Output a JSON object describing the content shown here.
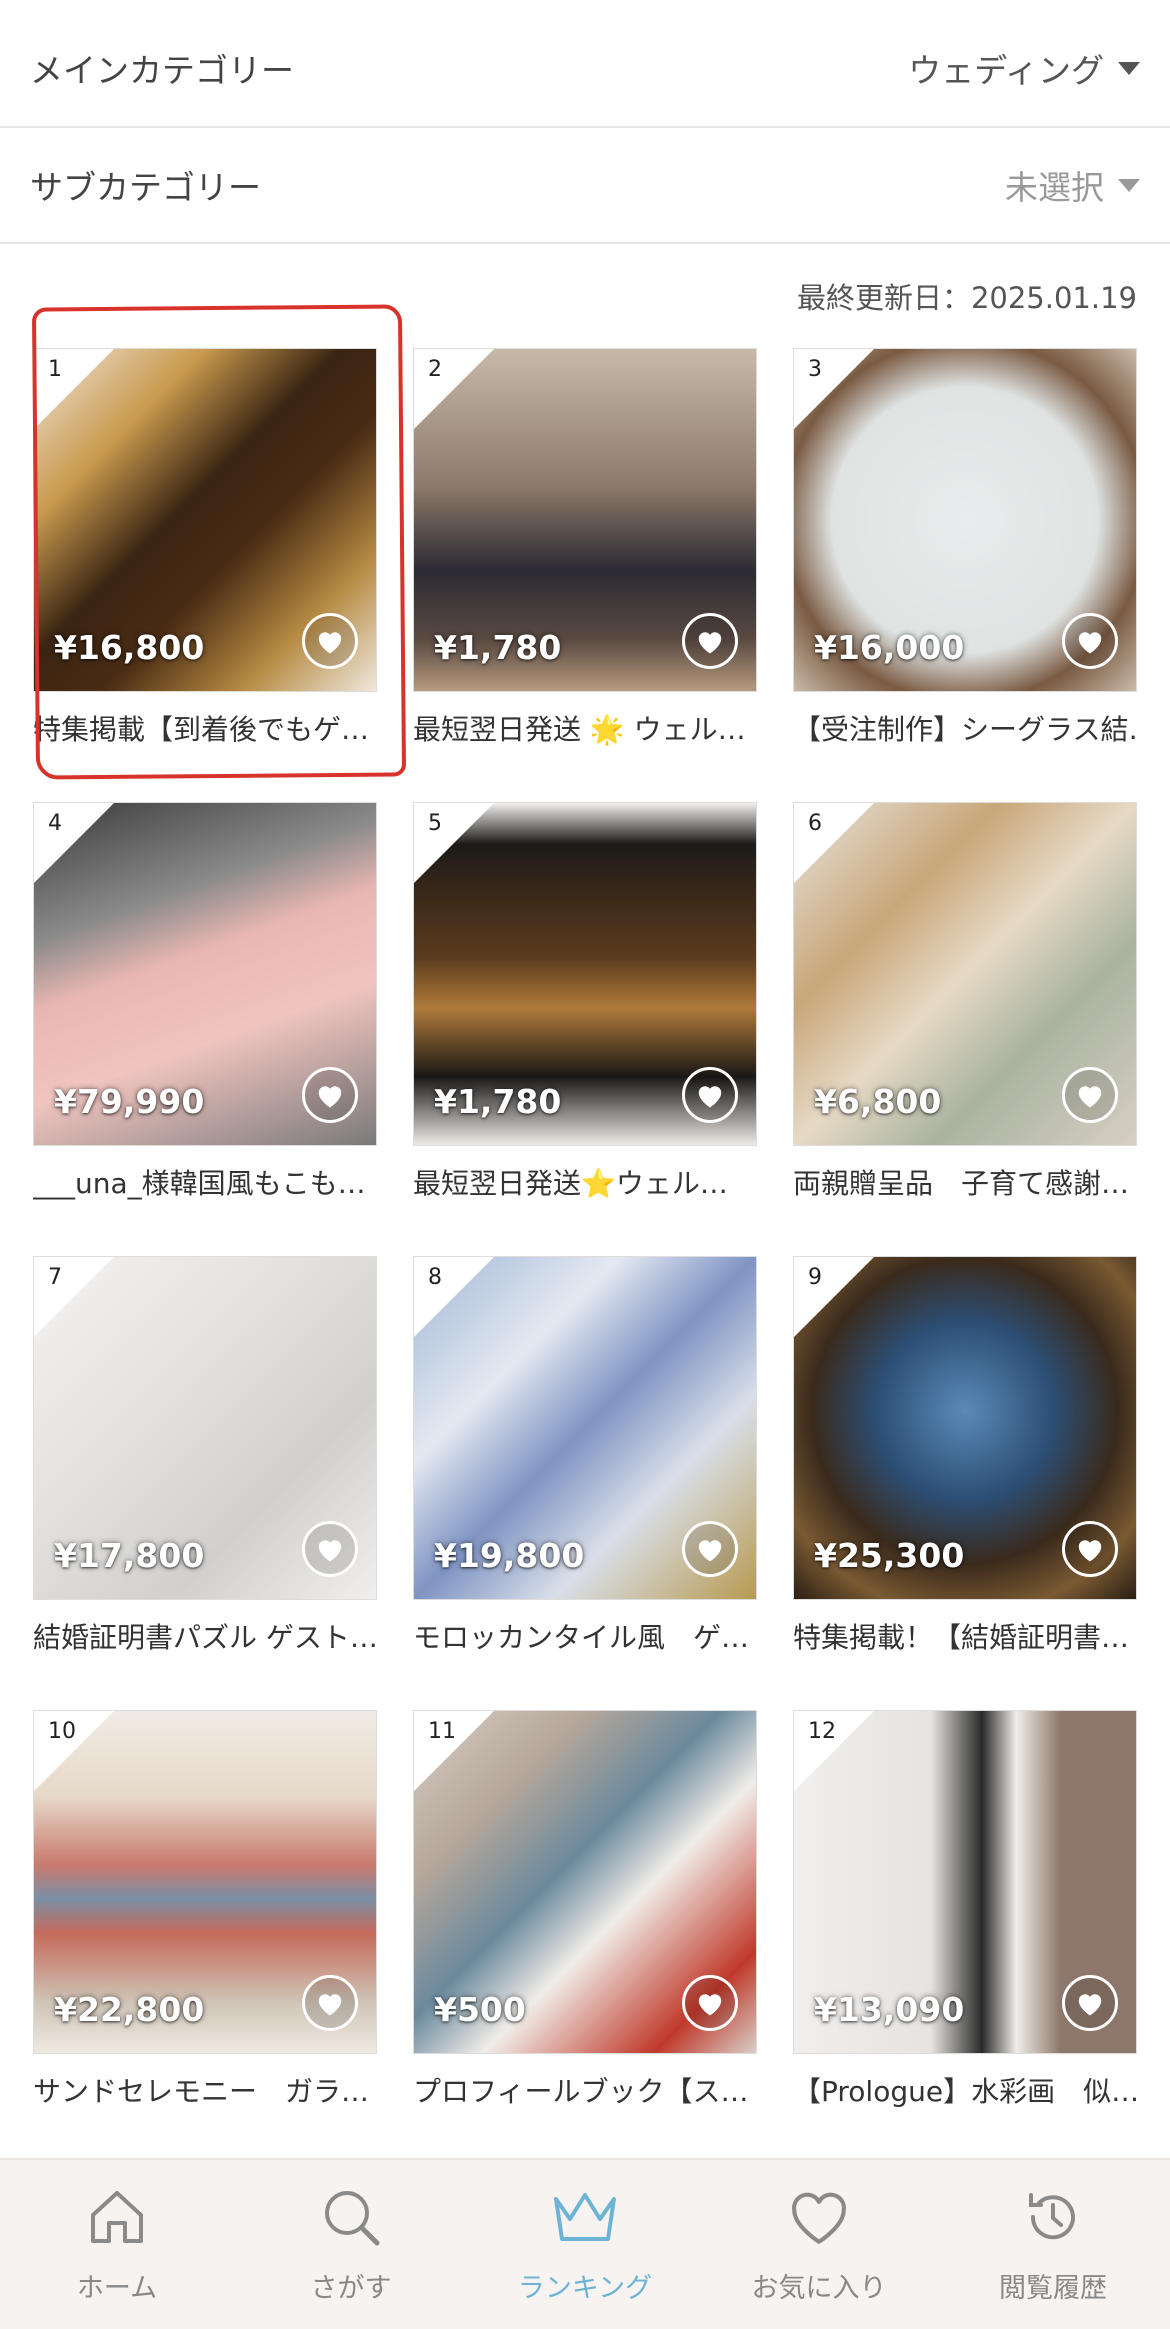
{
  "filters": {
    "main_label": "メインカテゴリー",
    "main_value": "ウェディング",
    "sub_label": "サブカテゴリー",
    "sub_value": "未選択"
  },
  "updated_text": "最終更新日：2025.01.19",
  "items": [
    {
      "rank": "1",
      "price": "¥16,800",
      "title": "特集掲載【到着後でもゲ…"
    },
    {
      "rank": "2",
      "price": "¥1,780",
      "title": "最短翌日発送 🌟 ウェル…"
    },
    {
      "rank": "3",
      "price": "¥16,000",
      "title": "【受注制作】シーグラス結…"
    },
    {
      "rank": "4",
      "price": "¥79,990",
      "title": "___una_様韓国風もこも…"
    },
    {
      "rank": "5",
      "price": "¥1,780",
      "title": "最短翌日発送⭐ウェル…"
    },
    {
      "rank": "6",
      "price": "¥6,800",
      "title": "両親贈呈品　子育て感謝…"
    },
    {
      "rank": "7",
      "price": "¥17,800",
      "title": "結婚証明書パズル ゲスト…"
    },
    {
      "rank": "8",
      "price": "¥19,800",
      "title": "モロッカンタイル風　ゲ…"
    },
    {
      "rank": "9",
      "price": "¥25,300",
      "title": "特集掲載！【結婚証明書…"
    },
    {
      "rank": "10",
      "price": "¥22,800",
      "title": "サンドセレモニー　ガラ…"
    },
    {
      "rank": "11",
      "price": "¥500",
      "title": "プロフィールブック【ス…"
    },
    {
      "rank": "12",
      "price": "¥13,090",
      "title": "【Prologue】水彩画　似…"
    }
  ],
  "tabs": [
    {
      "label": "ホーム",
      "icon": "home-icon"
    },
    {
      "label": "さがす",
      "icon": "search-icon"
    },
    {
      "label": "ランキング",
      "icon": "crown-icon"
    },
    {
      "label": "お気に入り",
      "icon": "heart-icon"
    },
    {
      "label": "閲覧履歴",
      "icon": "history-icon"
    }
  ],
  "colors": {
    "accent": "#6db4d4",
    "highlight": "#d8332a"
  }
}
